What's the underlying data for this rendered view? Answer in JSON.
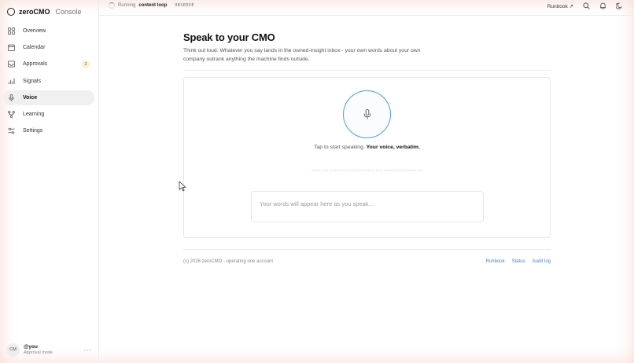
{
  "brand": {
    "name": "zeroCMO",
    "suffix": "Console"
  },
  "sidebar": {
    "items": [
      {
        "label": "Overview",
        "icon": "grid-icon",
        "active": false
      },
      {
        "label": "Calendar",
        "icon": "calendar-icon",
        "active": false
      },
      {
        "label": "Approvals",
        "icon": "inbox-icon",
        "active": false,
        "badge": "2"
      },
      {
        "label": "Signals",
        "icon": "bars-icon",
        "active": false
      },
      {
        "label": "Voice",
        "icon": "microphone-icon",
        "active": true
      },
      {
        "label": "Learning",
        "icon": "branch-icon",
        "active": false
      },
      {
        "label": "Settings",
        "icon": "sliders-icon",
        "active": false
      }
    ]
  },
  "user": {
    "initials": "CM",
    "handle": "@you",
    "mode": "Approval mode",
    "more": "···"
  },
  "topbar": {
    "status_running": "Running",
    "status_loop": "content loop",
    "status_sep": "·",
    "status_mode": "OBSERVE",
    "runbook_label": "Runbook ↗"
  },
  "main": {
    "title": "Speak to your CMO",
    "intro": "Think out loud. Whatever you say lands in the owned-insight inbox - your own words about your own company outrank anything the machine finds outside.",
    "hint_prefix": "Tap to start speaking.",
    "hint_strong": "Your voice, verbatim.",
    "transcript_placeholder": "Your words will appear here as you speak..."
  },
  "footer": {
    "copyright": "(c) 2026 zeroCMO - operating one account",
    "links": [
      "Runbook",
      "Status",
      "Audit log"
    ]
  },
  "colors": {
    "accent": "#4a9fd8",
    "link": "#4a86c5",
    "active_bg": "#f0f0f0",
    "badge_bg": "#fbefd6"
  }
}
